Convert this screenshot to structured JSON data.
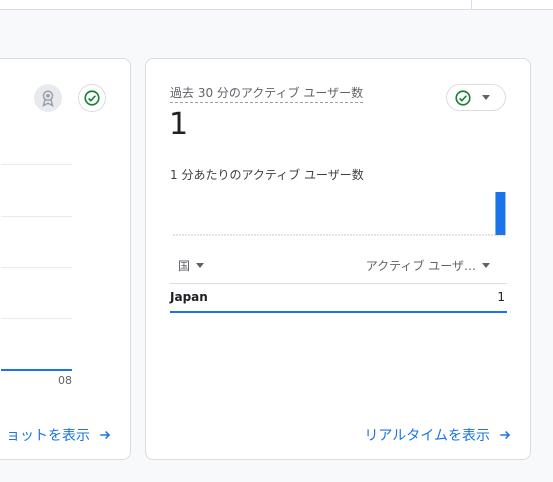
{
  "left_card": {
    "x_tick": "08",
    "link_label": "ョットを表示"
  },
  "right_card": {
    "metric_label": "過去 30 分のアクティブ ユーザー数",
    "metric_value": "1",
    "subtitle": "1 分あたりのアクティブ ユーザー数",
    "table": {
      "columns": [
        "国",
        "アクティブ ユーザ…"
      ],
      "rows": [
        {
          "country": "Japan",
          "users": "1"
        }
      ]
    },
    "link_label": "リアルタイムを表示"
  },
  "sparkline": {
    "values": [
      0,
      0,
      0,
      0,
      0,
      0,
      0,
      0,
      0,
      0,
      0,
      0,
      0,
      0,
      0,
      0,
      0,
      0,
      0,
      0,
      0,
      0,
      0,
      0,
      0,
      0,
      0,
      0,
      0,
      1
    ],
    "bar_color": "#1a73e8"
  },
  "colors": {
    "accent": "#1a73e8",
    "check": "#188038"
  }
}
